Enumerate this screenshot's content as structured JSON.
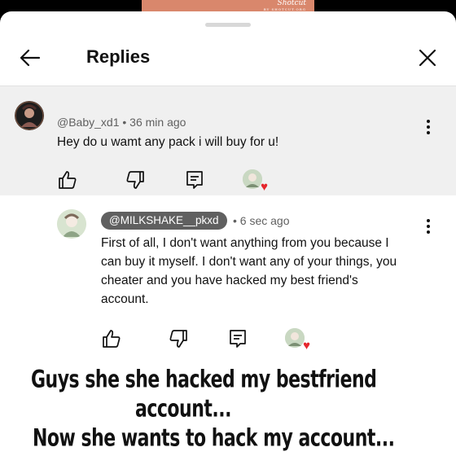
{
  "brand": {
    "name": "Shotcut",
    "tagline": "BY SHOTCUT.ORG"
  },
  "header": {
    "title": "Replies"
  },
  "parent_comment": {
    "author": "@Baby_xd1",
    "separator": "•",
    "time": "36 min ago",
    "text": "Hey do u wamt any pack i will buy for u!"
  },
  "reply": {
    "author": "@MILKSHAKE__pkxd",
    "separator": "•",
    "time": "6 sec ago",
    "text_lines": [
      "First of all, I don't want anything from you because I",
      "can buy it myself. I don't want any of your things, you",
      "cheater and you have hacked my best friend's",
      "account."
    ]
  },
  "caption": {
    "line1": "Guys she she hacked my bestfriend",
    "line2": "account...",
    "line3": "Now she wants to hack my account..."
  },
  "colors": {
    "heart": "#e5262c",
    "parent_bg": "#f0f0f0",
    "chip_bg": "#606060"
  }
}
